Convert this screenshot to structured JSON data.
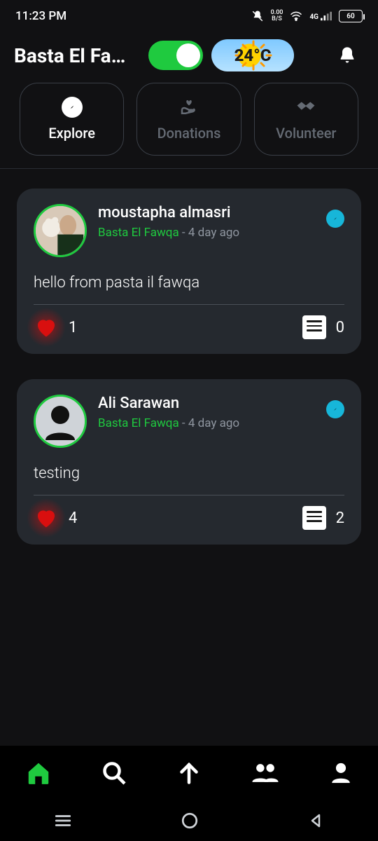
{
  "status": {
    "time": "11:23 PM",
    "data_rate_top": "0.00",
    "data_rate_bottom": "B/S",
    "network": "4G",
    "battery": "60"
  },
  "header": {
    "title": "Basta El Fa…",
    "weather": "24°C"
  },
  "tabs": {
    "explore": "Explore",
    "donations": "Donations",
    "volunteer": "Volunteer"
  },
  "posts": [
    {
      "author": "moustapha almasri",
      "location": "Basta El Fawqa",
      "time_sep": " - ",
      "time": "4 day ago",
      "body": "hello from pasta il fawqa",
      "likes": "1",
      "comments": "0"
    },
    {
      "author": "Ali Sarawan",
      "location": "Basta El Fawqa",
      "time_sep": " - ",
      "time": "4 day ago",
      "body": "testing",
      "likes": "4",
      "comments": "2"
    }
  ]
}
